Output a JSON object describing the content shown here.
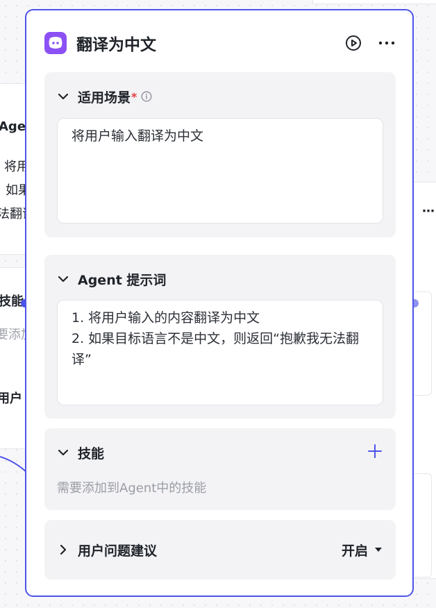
{
  "panel": {
    "title": "翻译为中文",
    "icons": {
      "app": "bot-face-icon",
      "run": "play-circle-icon",
      "more": "more-horizontal-icon"
    }
  },
  "scene": {
    "title": "适用场景",
    "required_mark": "*",
    "info_icon": "info-icon",
    "value": "将用户输入翻译为中文"
  },
  "prompt": {
    "title": "Agent 提示词",
    "value": "1. 将用户输入的内容翻译为中文\n2. 如果目标语言不是中文，则返回“抱歉我无法翻译”"
  },
  "skills": {
    "title": "技能",
    "placeholder": "需要添加到Agent中的技能",
    "add_icon": "plus-icon"
  },
  "suggest": {
    "title": "用户问题建议",
    "status": "开启",
    "dropdown_icon": "caret-down-icon"
  },
  "background": {
    "agent_label": "Age",
    "line1": "将用",
    "line2": "如果",
    "line3": "法翻译",
    "skills_label": "技能",
    "skills_hint": "要添加",
    "user_label": "用户",
    "more_icon": "more-horizontal-icon"
  },
  "colors": {
    "accent": "#4d53e8",
    "app_icon": "#8c51f5",
    "required": "#e63a3a"
  }
}
